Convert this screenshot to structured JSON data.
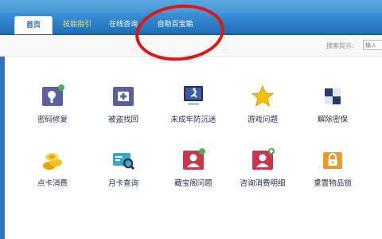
{
  "nav": {
    "tabs": [
      {
        "label": "首页",
        "active": true
      },
      {
        "label": "技能指引",
        "highlight": true
      },
      {
        "label": "在线咨询"
      },
      {
        "label": "自助百宝箱"
      }
    ]
  },
  "search": {
    "label": "搜索提示:",
    "placeholder": "输入"
  },
  "grid": {
    "items": [
      {
        "label": "密码修复",
        "icon": "key-lock-icon"
      },
      {
        "label": "被盗找回",
        "icon": "medical-kit-icon"
      },
      {
        "label": "未成年防沉迷",
        "icon": "computer-running-man-icon"
      },
      {
        "label": "游戏问题",
        "icon": "star-icon"
      },
      {
        "label": "解除密保",
        "icon": "cube-icon"
      },
      {
        "label": "点卡消费",
        "icon": "coins-icon"
      },
      {
        "label": "月卡查询",
        "icon": "card-search-icon"
      },
      {
        "label": "藏宝阁问题",
        "icon": "user-card-icon"
      },
      {
        "label": "咨询消费明细",
        "icon": "user-card-add-icon"
      },
      {
        "label": "重置物品锁",
        "icon": "padlock-icon"
      }
    ]
  },
  "colors": {
    "nav": "#2a7cc6",
    "annotation": "#e01616"
  }
}
